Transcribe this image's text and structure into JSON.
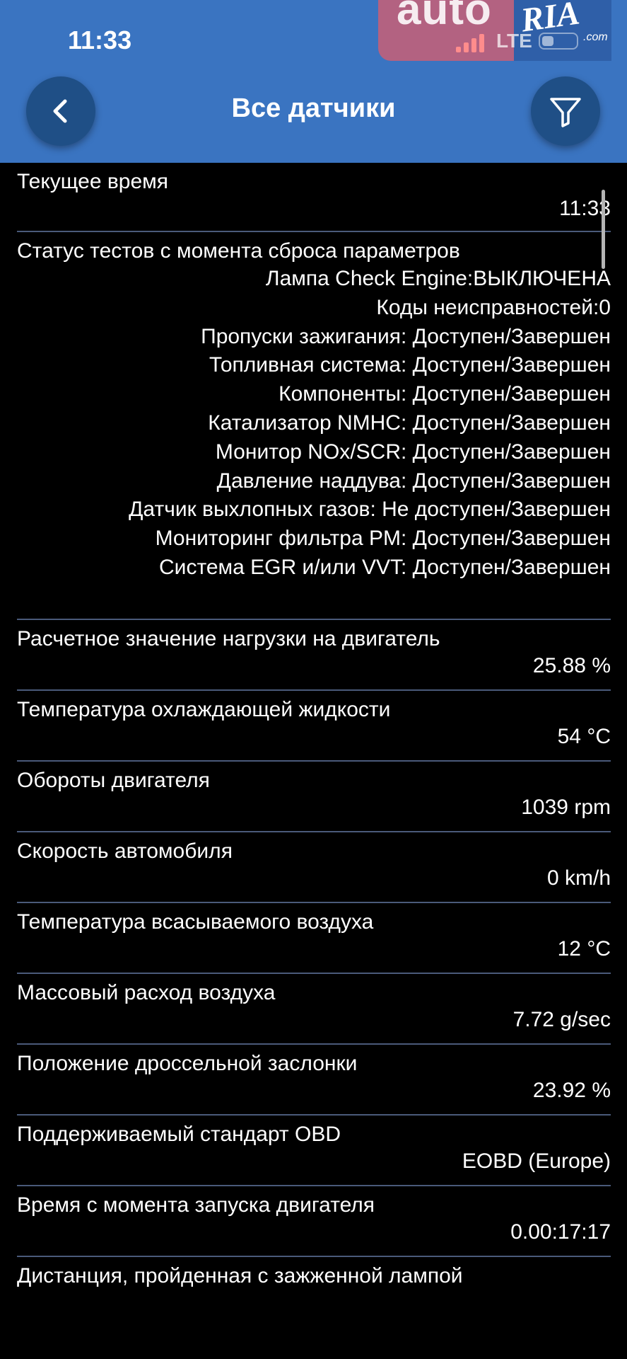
{
  "status_bar": {
    "time": "11:33",
    "network": "LTE",
    "watermark_word": "auto",
    "watermark_brand": "RIA",
    "watermark_domain": ".com"
  },
  "header": {
    "title": "Все датчики",
    "back_icon": "chevron-left-icon",
    "filter_icon": "filter-icon"
  },
  "colors": {
    "header_bg": "#3a74c1",
    "button_bg": "#1f4f86",
    "page_bg": "#000000",
    "divider": "#4a5a7a"
  },
  "sensors": [
    {
      "label": "Текущее время",
      "value": "11:33"
    },
    {
      "label": "Статус тестов с момента сброса параметров",
      "values": [
        "Лампа Check Engine:ВЫКЛЮЧЕНА",
        "Коды неисправностей:0",
        "Пропуски зажигания: Доступен/Завершен",
        "Топливная система: Доступен/Завершен",
        "Компоненты: Доступен/Завершен",
        "Катализатор NMHC: Доступен/Завершен",
        "Монитор NOx/SCR: Доступен/Завершен",
        "Давление наддува: Доступен/Завершен",
        "Датчик выхлопных газов: Не доступен/Завершен",
        "Мониторинг фильтра PM: Доступен/Завершен",
        "Система EGR и/или VVT: Доступен/Завершен"
      ]
    },
    {
      "label": "Расчетное значение нагрузки на двигатель",
      "value": "25.88 %"
    },
    {
      "label": "Температура охлаждающей жидкости",
      "value": "54 °C"
    },
    {
      "label": "Обороты двигателя",
      "value": "1039 rpm"
    },
    {
      "label": "Скорость автомобиля",
      "value": "0 km/h"
    },
    {
      "label": "Температура всасываемого воздуха",
      "value": "12 °C"
    },
    {
      "label": "Массовый расход воздуха",
      "value": "7.72 g/sec"
    },
    {
      "label": "Положение дроссельной заслонки",
      "value": "23.92 %"
    },
    {
      "label": "Поддерживаемый стандарт OBD",
      "value": "EOBD (Europe)"
    },
    {
      "label": "Время с момента запуска двигателя",
      "value": "0.00:17:17"
    },
    {
      "label": "Дистанция, пройденная с зажженной лампой",
      "value": ""
    }
  ]
}
